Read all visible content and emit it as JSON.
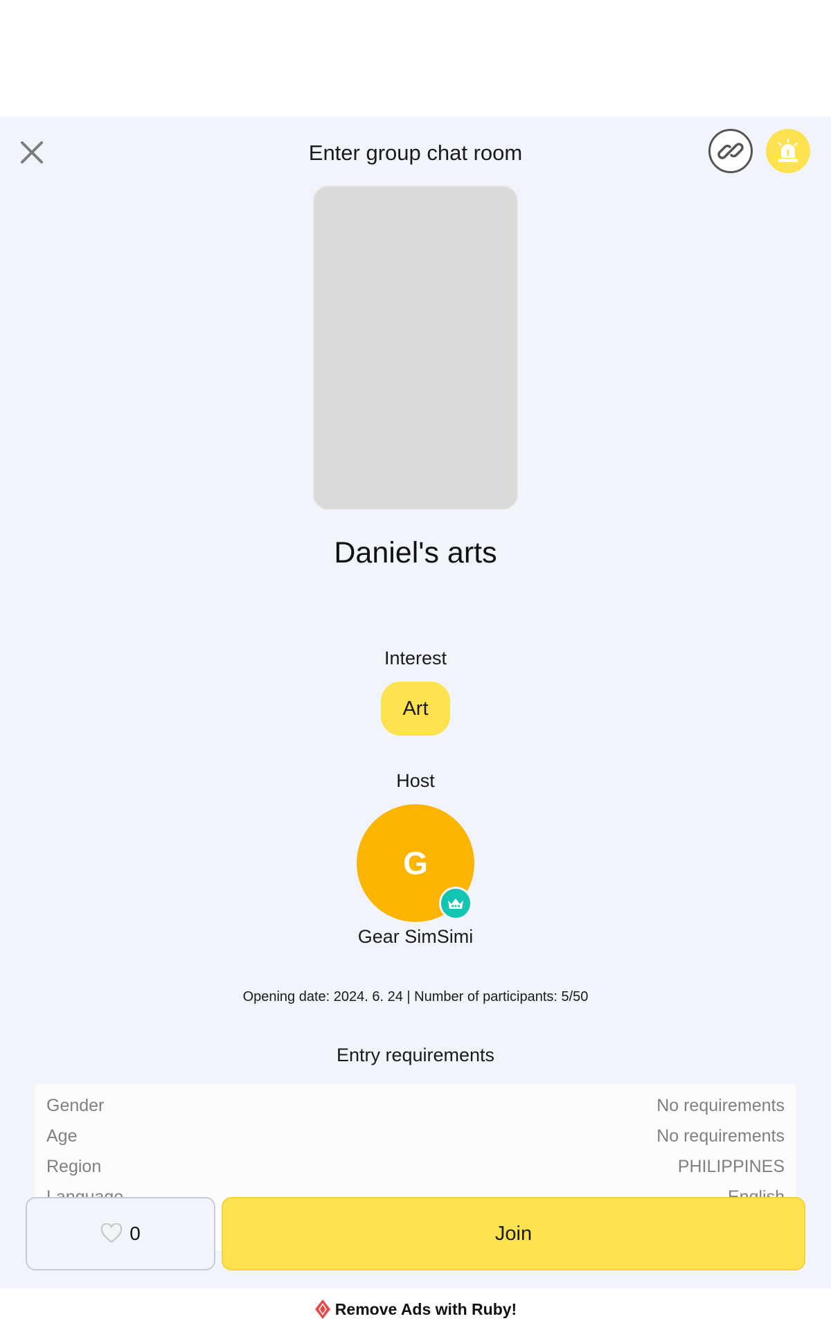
{
  "header": {
    "title": "Enter group chat room",
    "close_icon": "close-icon",
    "link_icon": "link-icon",
    "report_icon": "siren-icon"
  },
  "room": {
    "name": "Daniel's arts"
  },
  "interest": {
    "label": "Interest",
    "chip": "Art"
  },
  "host": {
    "label": "Host",
    "initial": "G",
    "name": "Gear SimSimi",
    "badge_icon": "crown-icon"
  },
  "info": {
    "text": "Opening date: 2024. 6. 24 | Number of participants: 5/50"
  },
  "requirements": {
    "title": "Entry requirements",
    "rows": [
      {
        "label": "Gender",
        "value": "No requirements"
      },
      {
        "label": "Age",
        "value": "No requirements"
      },
      {
        "label": "Region",
        "value": "PHILIPPINES"
      },
      {
        "label": "Language",
        "value": "English"
      }
    ]
  },
  "actions": {
    "like_count": "0",
    "join_label": "Join"
  },
  "ad": {
    "label": "Remove Ads with Ruby!",
    "icon": "ruby-icon"
  },
  "colors": {
    "accent_yellow": "#fde24f",
    "avatar_orange": "#fbb400",
    "badge_teal": "#13c4b0",
    "sheet_bg": "#f1f4fa"
  }
}
